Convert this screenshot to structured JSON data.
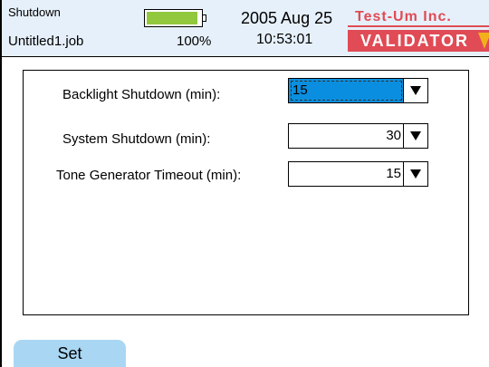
{
  "header": {
    "title": "Shutdown",
    "file": "Untitled1.job",
    "battery_level": 0.95,
    "battery_percent": "100%",
    "date": "2005 Aug 25",
    "time": "10:53:01",
    "brand_top": "Test-Um Inc.",
    "brand_bottom": "VALIDATOR"
  },
  "settings": [
    {
      "label": "Backlight Shutdown (min):",
      "value": "15",
      "selected": true
    },
    {
      "label": "System Shutdown (min):",
      "value": "30",
      "selected": false
    },
    {
      "label": "Tone Generator Timeout (min):",
      "value": "15",
      "selected": false
    }
  ],
  "footer": {
    "set_label": "Set"
  },
  "colors": {
    "header_bg": "#e6f0fa",
    "battery_fill": "#92c83e",
    "brand_red": "#e04b55",
    "selection": "#0a8fe0",
    "button": "#a9d7f3"
  }
}
